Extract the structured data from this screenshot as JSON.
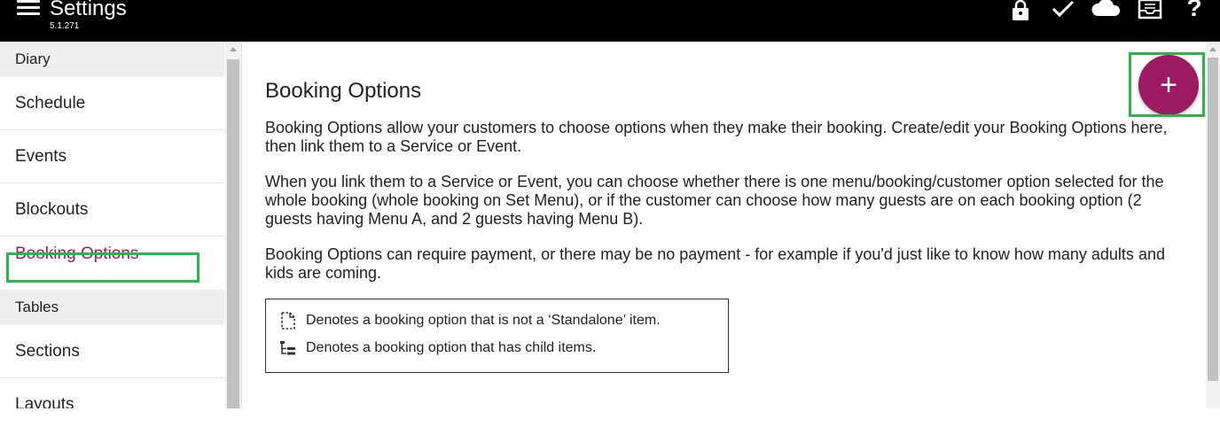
{
  "header": {
    "title": "Settings",
    "version": "5.1.271",
    "icons": [
      "menu-icon",
      "lock-icon",
      "check-icon",
      "cloud-icon",
      "inbox-icon",
      "help-icon"
    ],
    "help_label": "?"
  },
  "sidebar": {
    "items": [
      {
        "type": "section",
        "label": "Diary"
      },
      {
        "type": "item",
        "label": "Schedule"
      },
      {
        "type": "item",
        "label": "Events"
      },
      {
        "type": "item",
        "label": "Blockouts"
      },
      {
        "type": "item",
        "label": "Booking Options",
        "active": true
      },
      {
        "type": "section",
        "label": "Tables"
      },
      {
        "type": "item",
        "label": "Sections"
      },
      {
        "type": "item",
        "label": "Layouts"
      }
    ]
  },
  "main": {
    "title": "Booking Options",
    "paragraphs": [
      "Booking Options allow your customers to choose options when they make their booking. Create/edit your Booking Options here, then link them to a Service or Event.",
      "When you link them to a Service or Event, you can choose whether there is one menu/booking/customer option selected for the whole booking (whole booking on Set Menu), or if the customer can choose how many guests are on each booking option (2 guests having Menu A, and 2 guests having Menu B).",
      "Booking Options can require payment, or there may be no payment - for example if you'd just like to know how many adults and kids are coming."
    ],
    "legend": [
      {
        "icon": "dashed-document-icon",
        "text": "Denotes a booking option that is not a ‘Standalone’ item."
      },
      {
        "icon": "hierarchy-icon",
        "text": "Denotes a booking option that has child items."
      }
    ],
    "fab_label": "+"
  },
  "colors": {
    "accent": "#9c1a62",
    "highlight": "#2db44a",
    "header_bg": "#000000"
  }
}
